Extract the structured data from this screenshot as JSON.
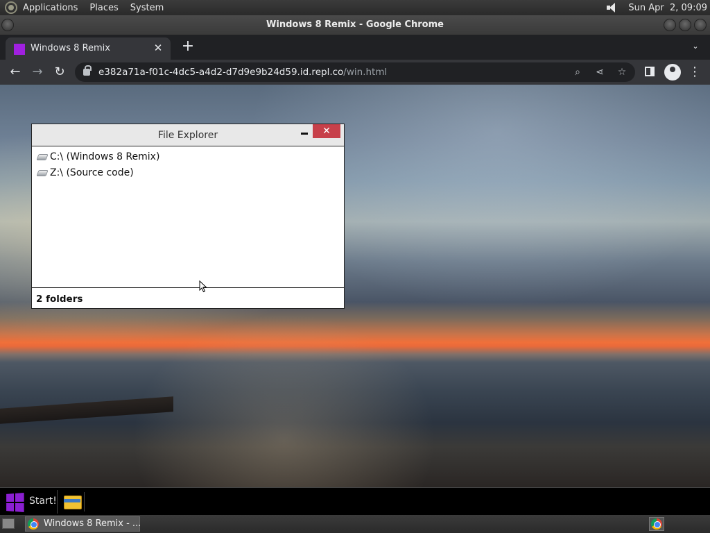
{
  "top_panel": {
    "menus": [
      "Applications",
      "Places",
      "System"
    ],
    "clock": "Sun Apr  2, 09:09"
  },
  "window": {
    "title": "Windows 8 Remix - Google Chrome"
  },
  "tabs": [
    {
      "label": "Windows 8 Remix",
      "favicon_color": "#a020e0"
    }
  ],
  "address_bar": {
    "host": "e382a71a-f01c-4dc5-a4d2-d7d9e9b24d59.id.repl.co",
    "path": "/win.html"
  },
  "file_explorer": {
    "title": "File Explorer",
    "close_label": "✕",
    "items": [
      {
        "label": "C:\\ (Windows 8 Remix)"
      },
      {
        "label": "Z:\\ (Source code)"
      }
    ],
    "status": "2 folders"
  },
  "w8_taskbar": {
    "start_label": "Start!",
    "accent": "#8b1fd1"
  },
  "bottom_panel": {
    "task_label": "Windows 8 Remix - ..."
  },
  "colors": {
    "close_button": "#c7404a",
    "chrome_toolbar": "#35363a",
    "chrome_tabstrip": "#202124"
  }
}
